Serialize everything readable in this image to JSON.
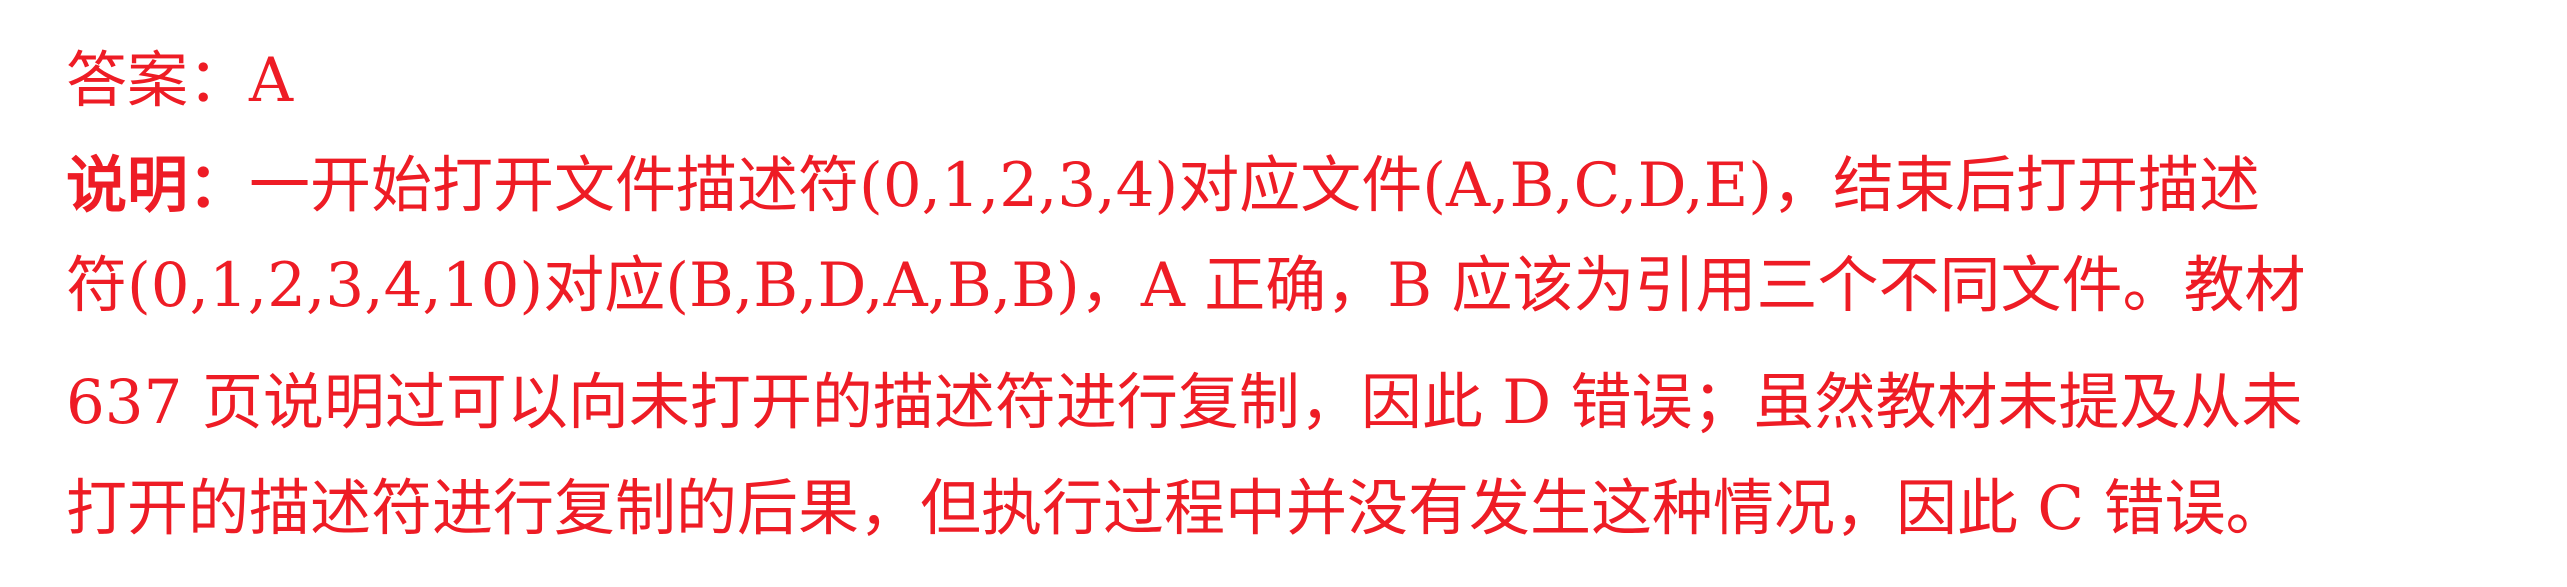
{
  "answer": {
    "label": "答案：",
    "value": "A"
  },
  "explanation": {
    "label": "说明：",
    "line1": "一开始打开文件描述符(0,1,2,3,4)对应文件(A,B,C,D,E)，结束后打开描述",
    "line2": "符(0,1,2,3,4,10)对应(B,B,D,A,B,B)，A 正确，B 应该为引用三个不同文件。教材",
    "line3": "637 页说明过可以向未打开的描述符进行复制，因此 D 错误；虽然教材未提及从未",
    "line4": "打开的描述符进行复制的后果，但执行过程中并没有发生这种情况，因此 C 错误。"
  }
}
